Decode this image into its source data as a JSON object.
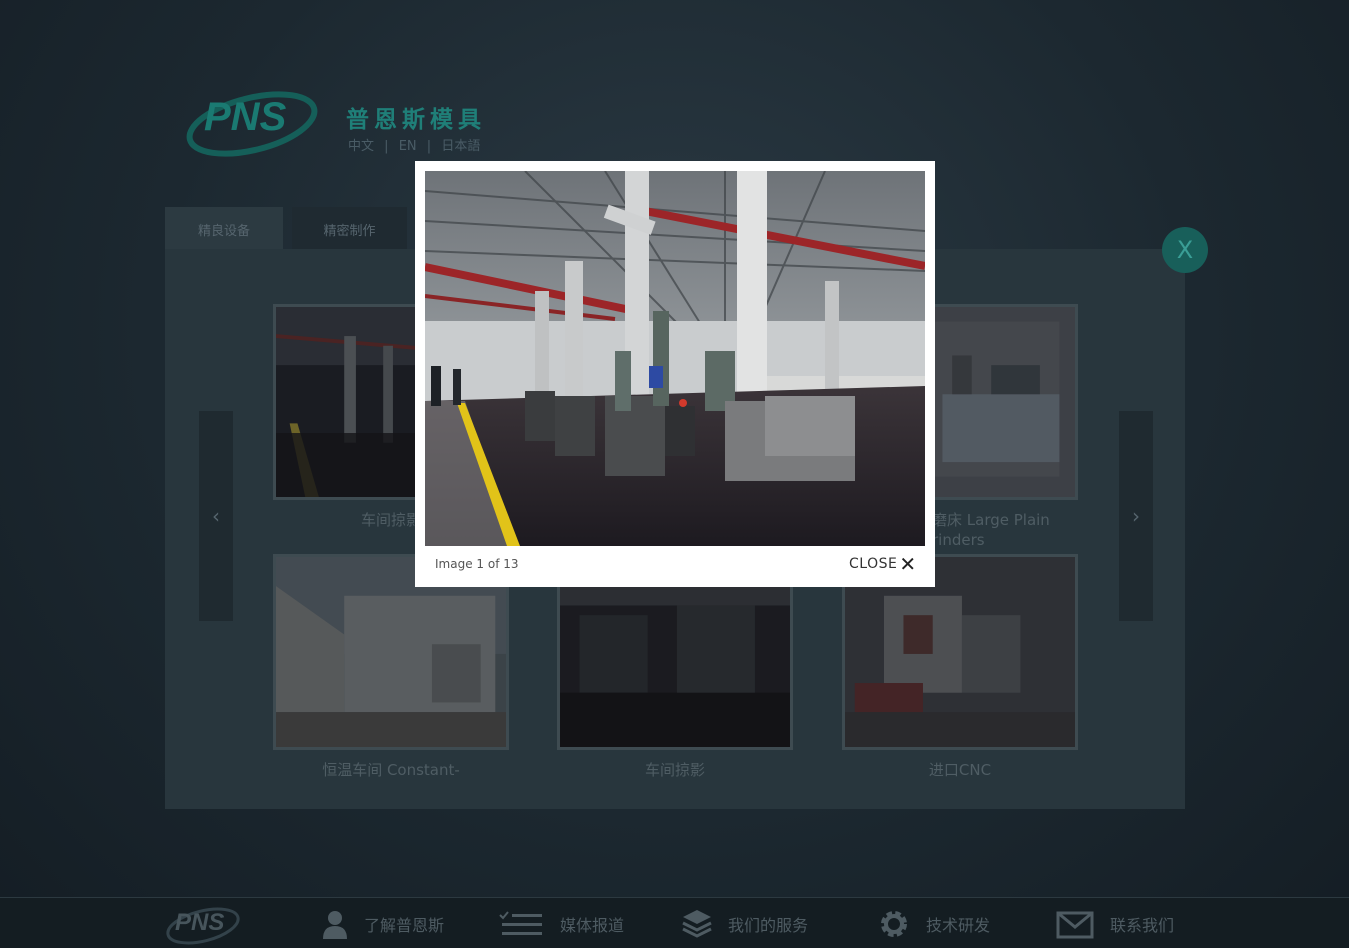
{
  "header": {
    "logo_text": "PNS",
    "brand_cn": "普恩斯模具",
    "languages": [
      "中文",
      "EN",
      "日本語"
    ],
    "lang_separator": "|"
  },
  "tabs": [
    {
      "label": "精良设备",
      "active": true
    },
    {
      "label": "精密制作",
      "active": false
    }
  ],
  "panel": {
    "close_label": "X",
    "prev_icon": "chevron-left-icon",
    "next_icon": "chevron-right-icon",
    "prev_glyph": "‹",
    "next_glyph": "›"
  },
  "gallery": [
    {
      "caption": "车间掠影"
    },
    {
      "caption": "平面磨床 Large Plain Grinders"
    },
    {
      "caption": "恒温车间 Constant-"
    },
    {
      "caption": "车间掠影"
    },
    {
      "caption": "进口CNC"
    }
  ],
  "caption_visible": {
    "c1": "车间掠影",
    "c2_line1": "磨床 Large Plain",
    "c2_line2": "rinders",
    "c3": "恒温车间 Constant-",
    "c4": "车间掠影",
    "c5": "进口CNC"
  },
  "lightbox": {
    "counter": "Image 1 of 13",
    "close_label": "CLOSE",
    "close_icon": "✕"
  },
  "footer": {
    "logo_text": "PNS",
    "items": [
      {
        "label": "了解普恩斯",
        "icon": "user-icon"
      },
      {
        "label": "媒体报道",
        "icon": "list-icon"
      },
      {
        "label": "我们的服务",
        "icon": "layers-icon"
      },
      {
        "label": "技术研发",
        "icon": "gear-icon"
      },
      {
        "label": "联系我们",
        "icon": "mail-icon"
      }
    ]
  },
  "colors": {
    "brand_green": "#1f7f78",
    "overlay_close_bg": "#185f5a",
    "lightbox_bg": "#ffffff"
  }
}
